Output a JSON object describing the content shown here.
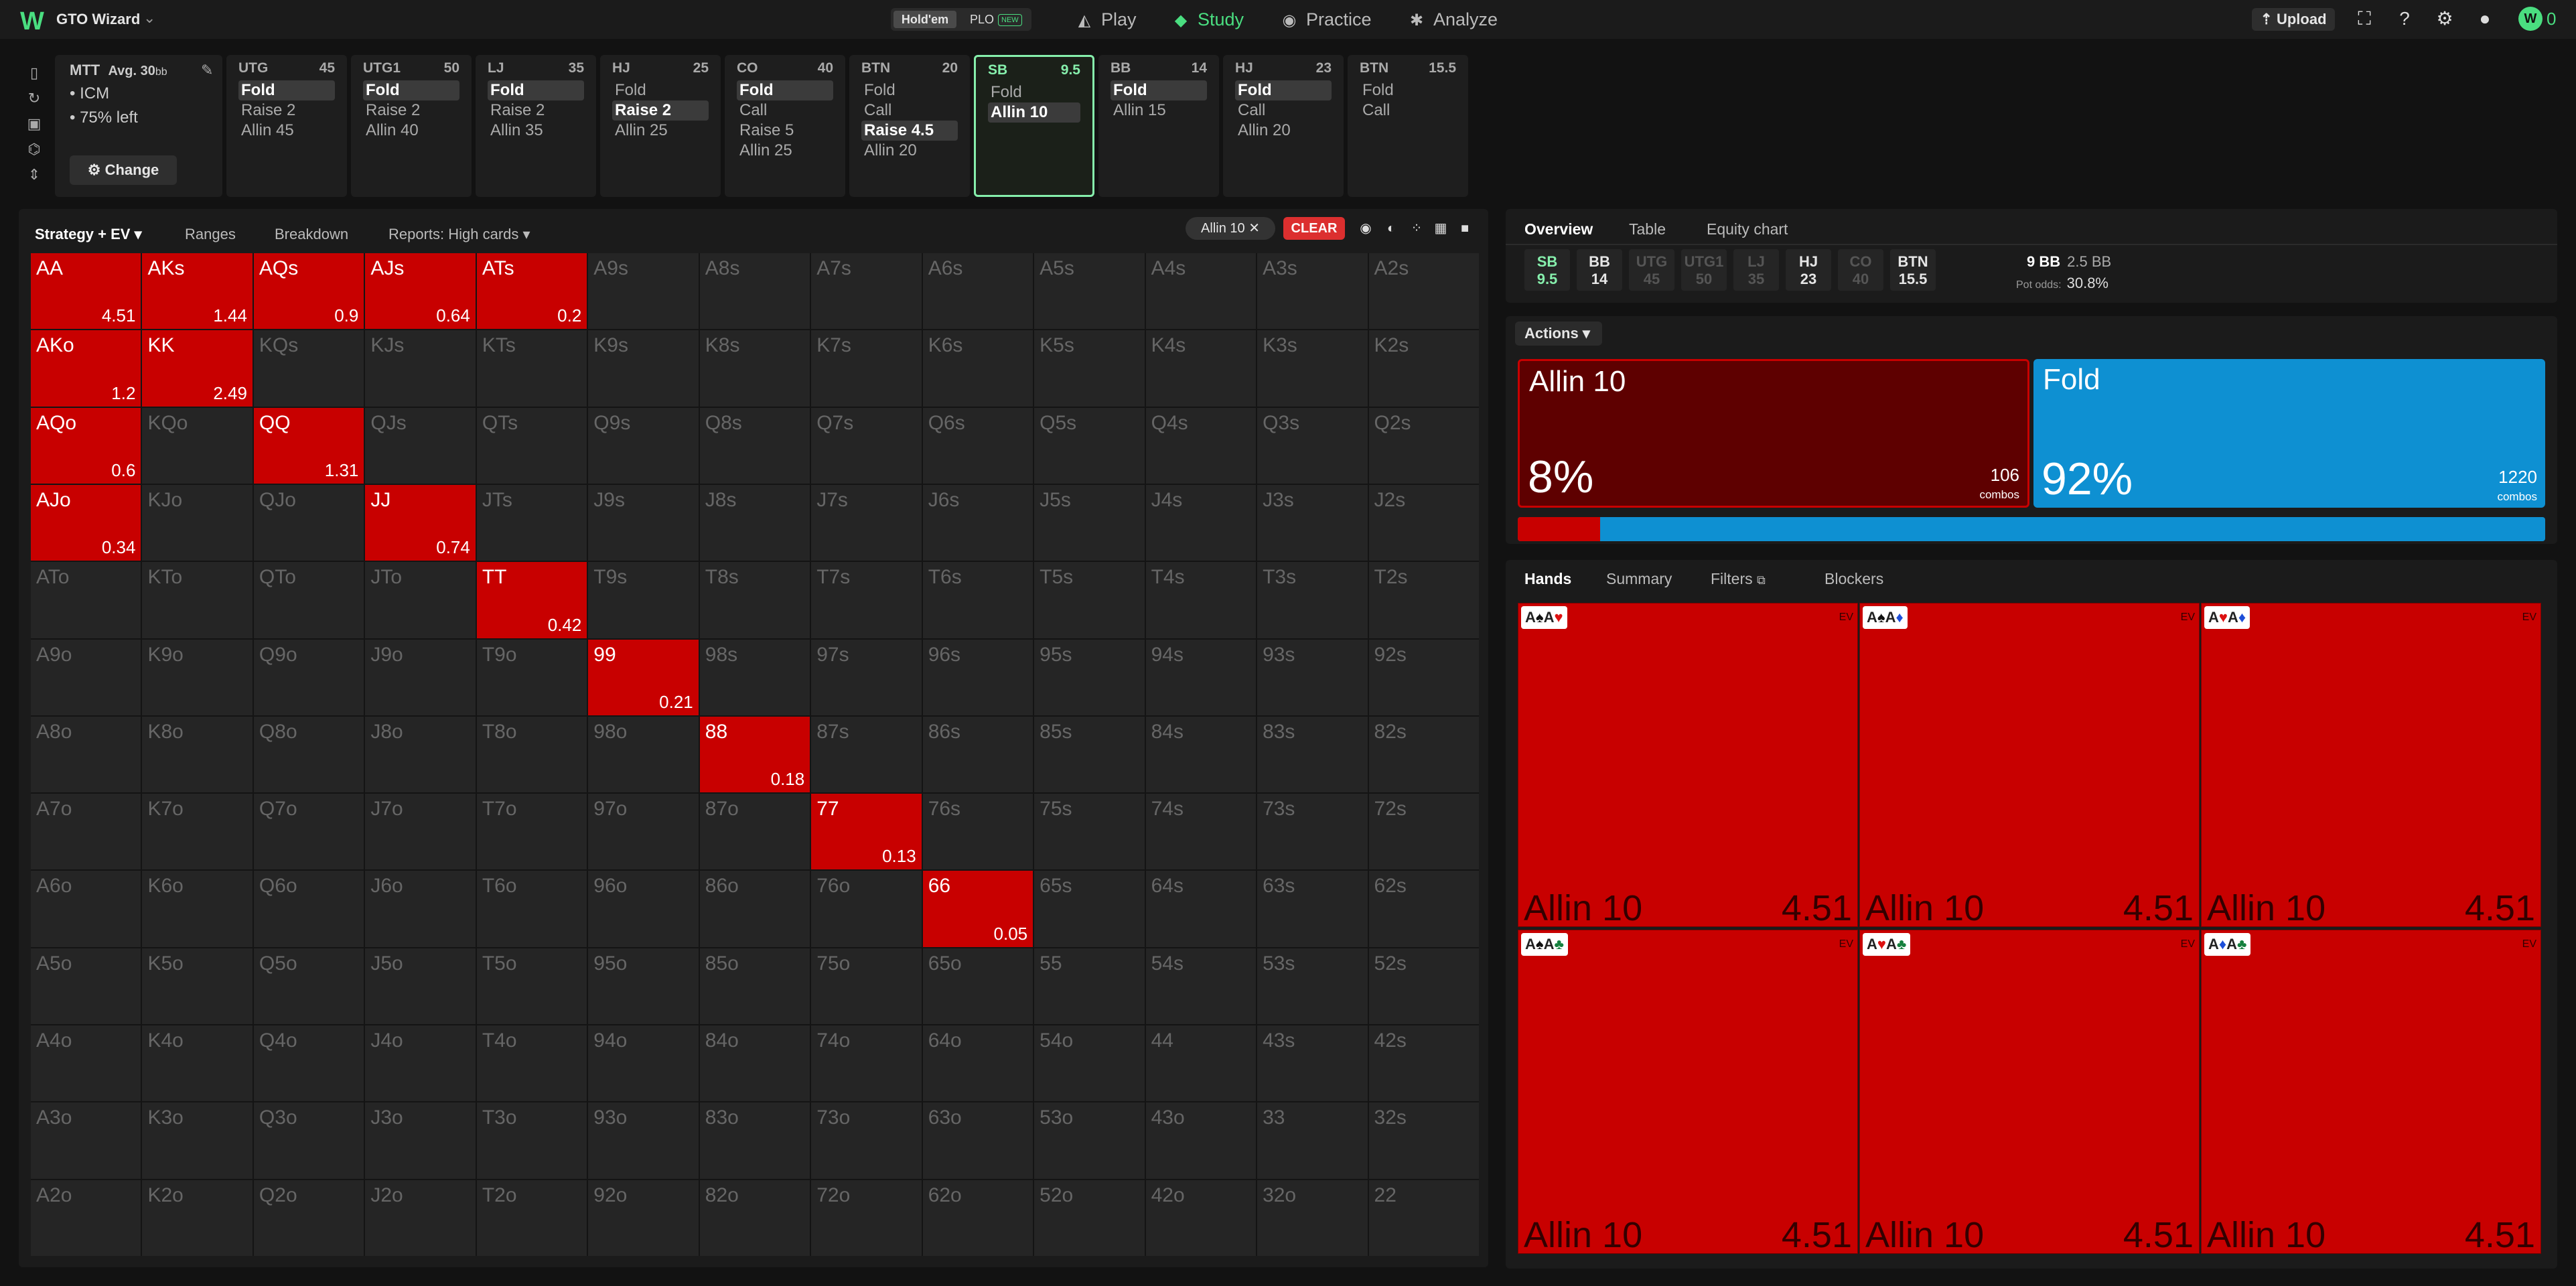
{
  "topbar": {
    "brand": "GTO Wizard",
    "game_holdem": "Hold'em",
    "game_plo": "PLO",
    "new_badge": "NEW",
    "nav": [
      {
        "label": "Play",
        "icon": "play-icon"
      },
      {
        "label": "Study",
        "icon": "study-icon",
        "active": true
      },
      {
        "label": "Practice",
        "icon": "practice-icon"
      },
      {
        "label": "Analyze",
        "icon": "analyze-icon"
      }
    ],
    "upload": "Upload",
    "user_badge": "W",
    "user_count": "0",
    "accent": "#4ade80"
  },
  "settings": {
    "title": "MTT",
    "avg_label": "Avg. 30",
    "avg_unit": "bb",
    "items": [
      "ICM",
      "75% left"
    ],
    "change": "Change"
  },
  "positions": [
    {
      "name": "UTG",
      "stack": "45",
      "actions": [
        "Fold",
        "Raise 2",
        "Allin 45"
      ],
      "selected": 0
    },
    {
      "name": "UTG1",
      "stack": "50",
      "actions": [
        "Fold",
        "Raise 2",
        "Allin 40"
      ],
      "selected": 0
    },
    {
      "name": "LJ",
      "stack": "35",
      "actions": [
        "Fold",
        "Raise 2",
        "Allin 35"
      ],
      "selected": 0
    },
    {
      "name": "HJ",
      "stack": "25",
      "actions": [
        "Fold",
        "Raise 2",
        "Allin 25"
      ],
      "selected": 1
    },
    {
      "name": "CO",
      "stack": "40",
      "actions": [
        "Fold",
        "Call",
        "Raise 5",
        "Allin 25"
      ],
      "selected": 0
    },
    {
      "name": "BTN",
      "stack": "20",
      "actions": [
        "Fold",
        "Call",
        "Raise 4.5",
        "Allin 20"
      ],
      "selected": 2
    },
    {
      "name": "SB",
      "stack": "9.5",
      "actions": [
        "Fold",
        "Allin 10"
      ],
      "selected": 1,
      "active": true
    },
    {
      "name": "BB",
      "stack": "14",
      "actions": [
        "Fold",
        "Allin 15"
      ],
      "selected": 0
    },
    {
      "name": "HJ",
      "stack": "23",
      "actions": [
        "Fold",
        "Call",
        "Allin 20"
      ],
      "selected": 0
    },
    {
      "name": "BTN",
      "stack": "15.5",
      "actions": [
        "Fold",
        "Call"
      ],
      "selected": -1
    }
  ],
  "grid_toolbar": {
    "mode": "Strategy + EV",
    "ranges": "Ranges",
    "breakdown": "Breakdown",
    "reports": "Reports: High cards",
    "filter_chip": "Allin 10",
    "clear": "CLEAR"
  },
  "matrix": {
    "ranks": [
      "A",
      "K",
      "Q",
      "J",
      "T",
      "9",
      "8",
      "7",
      "6",
      "5",
      "4",
      "3",
      "2"
    ],
    "highlighted": {
      "AA": "4.51",
      "AKs": "1.44",
      "AQs": "0.9",
      "AJs": "0.64",
      "ATs": "0.2",
      "AKo": "1.2",
      "KK": "2.49",
      "AQo": "0.6",
      "QQ": "1.31",
      "AJo": "0.34",
      "JJ": "0.74",
      "TT": "0.42",
      "99": "0.21",
      "88": "0.18",
      "77": "0.13",
      "66": "0.05"
    },
    "highlight_color": "#c80000"
  },
  "right_tabs": [
    "Overview",
    "Table",
    "Equity chart"
  ],
  "players": [
    {
      "pos": "SB",
      "stack": "9.5",
      "state": "hero"
    },
    {
      "pos": "BB",
      "stack": "14",
      "state": "live"
    },
    {
      "pos": "UTG",
      "stack": "45",
      "state": "dim"
    },
    {
      "pos": "UTG1",
      "stack": "50",
      "state": "dim"
    },
    {
      "pos": "LJ",
      "stack": "35",
      "state": "dim"
    },
    {
      "pos": "HJ",
      "stack": "23",
      "state": "live"
    },
    {
      "pos": "CO",
      "stack": "40",
      "state": "dim"
    },
    {
      "pos": "BTN",
      "stack": "15.5",
      "state": "live"
    }
  ],
  "pot": {
    "main": "9 BB",
    "secondary": "2.5 BB",
    "odds_label": "Pot odds:",
    "odds_value": "30.8%"
  },
  "actions": {
    "dropdown": "Actions",
    "items": [
      {
        "name": "Allin 10",
        "pct": "8%",
        "combos": "106",
        "color": "#5e0000",
        "frac": 0.08
      },
      {
        "name": "Fold",
        "pct": "92%",
        "combos": "1220",
        "color": "#0e90d2",
        "frac": 0.92
      }
    ],
    "combos_label": "combos"
  },
  "hands_tabs": [
    "Hands",
    "Summary",
    "Filters",
    "Blockers"
  ],
  "combos": [
    {
      "cards": [
        [
          "A",
          "s"
        ],
        [
          "A",
          "h"
        ]
      ],
      "action": "Allin 10",
      "ev": "4.51"
    },
    {
      "cards": [
        [
          "A",
          "s"
        ],
        [
          "A",
          "d"
        ]
      ],
      "action": "Allin 10",
      "ev": "4.51"
    },
    {
      "cards": [
        [
          "A",
          "h"
        ],
        [
          "A",
          "d"
        ]
      ],
      "action": "Allin 10",
      "ev": "4.51"
    },
    {
      "cards": [
        [
          "A",
          "s"
        ],
        [
          "A",
          "c"
        ]
      ],
      "action": "Allin 10",
      "ev": "4.51"
    },
    {
      "cards": [
        [
          "A",
          "h"
        ],
        [
          "A",
          "c"
        ]
      ],
      "action": "Allin 10",
      "ev": "4.51"
    },
    {
      "cards": [
        [
          "A",
          "d"
        ],
        [
          "A",
          "c"
        ]
      ],
      "action": "Allin 10",
      "ev": "4.51"
    }
  ],
  "ev_label": "EV"
}
